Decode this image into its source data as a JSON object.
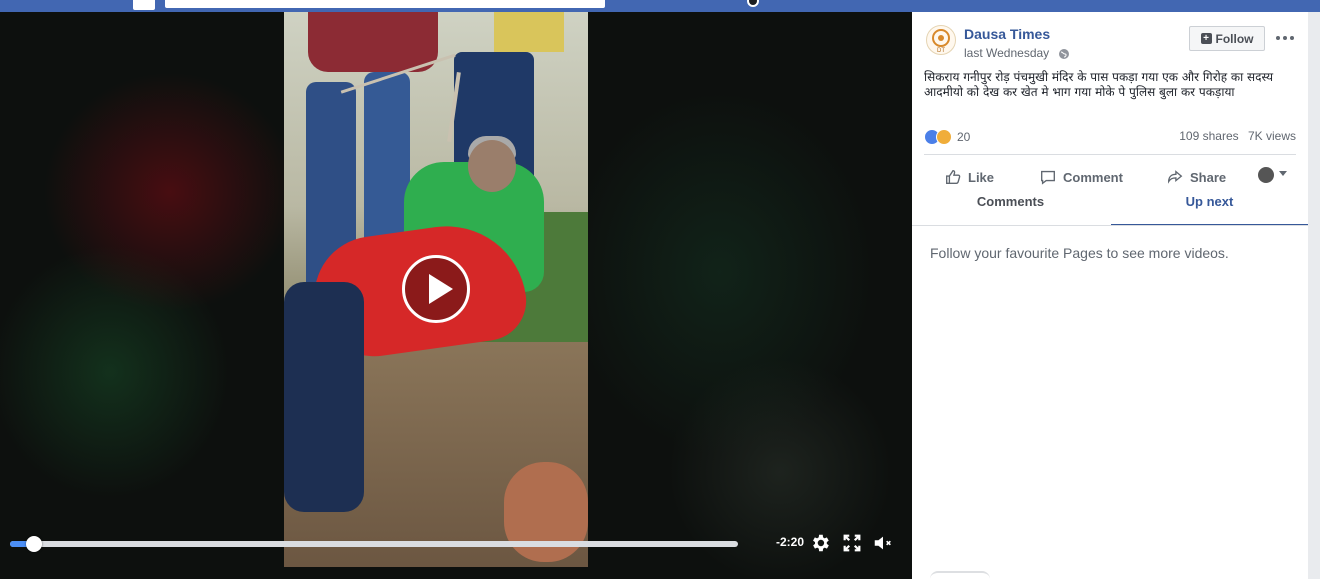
{
  "video": {
    "time_remaining": "-2:20",
    "progress_fraction": 0.033
  },
  "post": {
    "page_name": "Dausa Times",
    "page_logo_text": "DT",
    "date": "last Wednesday",
    "follow_label": "Follow",
    "caption": "सिकराय गनीपुर रोड़ पंचमुखी मंदिर के पास पकड़ा गया एक और गिरोह का सदस्य आदमीयो को देख कर खेत मे भाग गया मोके पे पुलिस बुला कर पकड़ाया",
    "reaction_count": "20",
    "shares": "109 shares",
    "views": "7K views"
  },
  "actions": {
    "like": "Like",
    "comment": "Comment",
    "share": "Share"
  },
  "tabs": {
    "comments": "Comments",
    "up_next": "Up next"
  },
  "up_next": {
    "empty_message": "Follow your favourite Pages to see more videos."
  },
  "colors": {
    "topbar": "#4267b2",
    "link": "#365899",
    "progress": "#4c8ff5"
  },
  "icons": [
    "facebook-logo-icon",
    "play-icon",
    "gear-icon",
    "fullscreen-icon",
    "volume-muted-icon",
    "globe-icon",
    "plus-icon",
    "more-icon",
    "like-icon",
    "comment-icon",
    "share-icon"
  ]
}
